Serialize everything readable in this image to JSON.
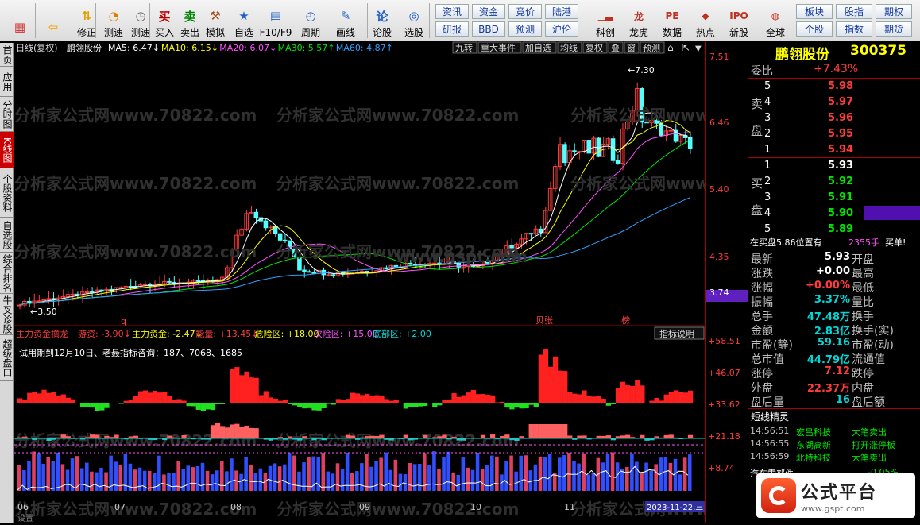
{
  "toolbar": {
    "buttons": [
      {
        "label": "",
        "icon": "grid-icon",
        "color": "#d03030"
      },
      {
        "label": "",
        "icon": "back-arrow-icon",
        "color": "#f0b020"
      },
      {
        "label": "修正",
        "icon": "up-down-arrows-icon",
        "color": "#e0a000"
      },
      {
        "label": "测速",
        "icon": "speedometer-icon",
        "color": "#e08000"
      },
      {
        "label": "测速",
        "icon": "clock-icon",
        "color": "#606060"
      },
      {
        "label": "买入",
        "icon": "buy-icon",
        "color": "#c00000"
      },
      {
        "label": "卖出",
        "icon": "sell-icon",
        "color": "#008000"
      },
      {
        "label": "模拟",
        "icon": "hammer-icon",
        "color": "#a05020"
      },
      {
        "label": "自选",
        "icon": "star-icon",
        "color": "#2060c0"
      },
      {
        "label": "F10/F9",
        "icon": "doc-icon",
        "color": "#2060c0"
      },
      {
        "label": "周期",
        "icon": "clock-cycle-icon",
        "color": "#2060c0"
      },
      {
        "label": "画线",
        "icon": "pen-icon",
        "color": "#2060c0"
      },
      {
        "label": "论股",
        "icon": "forum-icon",
        "color": "#2060c0"
      },
      {
        "label": "选股",
        "icon": "select-stock-icon",
        "color": "#2060c0"
      }
    ],
    "menu_buttons": [
      [
        "资讯",
        "资金",
        "竞价",
        "陆港"
      ],
      [
        "研报",
        "BBD",
        "预测",
        "沪伦"
      ]
    ],
    "buttons2": [
      {
        "label": "科创",
        "icon": "chart-icon"
      },
      {
        "label": "龙虎",
        "icon": "dragon-icon"
      },
      {
        "label": "数据",
        "icon": "pe-icon"
      },
      {
        "label": "热点",
        "icon": "hot-icon"
      },
      {
        "label": "新股",
        "icon": "ipo-icon"
      },
      {
        "label": "全球",
        "icon": "globe-icon"
      }
    ],
    "menu_buttons2": [
      [
        "板块",
        "股指",
        "期权"
      ],
      [
        "个股",
        "指数",
        "期货"
      ]
    ]
  },
  "lefttabs": [
    "首页",
    "应用",
    "分时图",
    "K线图",
    "个股资料",
    "自选股",
    "综合排名",
    "牛叉诊股",
    "超级盘口"
  ],
  "chart": {
    "title": "日线(复权)",
    "stock": "鹏翎股份",
    "ma": [
      {
        "label": "MA5: 6.47↓",
        "color": "#ffffff"
      },
      {
        "label": "MA10: 6.15↓",
        "color": "#ffff00"
      },
      {
        "label": "MA20: 6.07↓",
        "color": "#ff50ff"
      },
      {
        "label": "MA30: 5.57↑",
        "color": "#00e600"
      },
      {
        "label": "MA60: 4.87↑",
        "color": "#30a0ff"
      }
    ],
    "tabs": [
      "九转",
      "重大事件",
      "加自选",
      "均线",
      "复权",
      "叠",
      "窗",
      "预测"
    ],
    "high_label": "7.30",
    "low_label": "3.50",
    "marks": [
      "q",
      "贝张",
      "榜"
    ],
    "price_axis": [
      "7.51",
      "6.46",
      "5.40",
      "4.35",
      "3.74"
    ],
    "watermark": "分析家公式网www.70822.com",
    "watermark2": "www.gspt.com",
    "indicator": {
      "name": "主力资金擒龙",
      "items": [
        {
          "label": "游资: -3.90↓",
          "color": "#ff3c3c"
        },
        {
          "label": "主力资金: -2.47↓",
          "color": "#ffff00"
        },
        {
          "label": "能量: +13.45↓",
          "color": "#ff3c3c"
        },
        {
          "label": "危险区: +18.00",
          "color": "#ffff00"
        },
        {
          "label": "次险区: +15.00",
          "color": "#ff50ff"
        },
        {
          "label": "底部区: +2.00",
          "color": "#00d8d8"
        }
      ],
      "button": "指标说明",
      "note": "试用期到12月10日、老聂指标咨询：187、7068、1685",
      "axis": [
        "+58.51",
        "+46.07",
        "+33.62",
        "+21.18",
        "+8.74"
      ],
      "axis_labels": [
        "游资",
        "主力",
        "能量"
      ]
    },
    "dates": [
      "06",
      "07",
      "08",
      "09",
      "10",
      "11"
    ],
    "cursor_date": "2023-11-22,三",
    "bottom": "设置"
  },
  "panel": {
    "name": "鹏翎股份",
    "code": "300375",
    "weibi_label": "委比",
    "weibi": "+7.43%",
    "sell_label": "卖盘",
    "buy_label": "买盘",
    "sells": [
      {
        "n": "5",
        "p": "5.98"
      },
      {
        "n": "4",
        "p": "5.97"
      },
      {
        "n": "3",
        "p": "5.96"
      },
      {
        "n": "2",
        "p": "5.95"
      },
      {
        "n": "1",
        "p": "5.94"
      }
    ],
    "buys": [
      {
        "n": "1",
        "p": "5.93"
      },
      {
        "n": "2",
        "p": "5.92"
      },
      {
        "n": "3",
        "p": "5.91"
      },
      {
        "n": "4",
        "p": "5.90"
      },
      {
        "n": "5",
        "p": "5.89"
      }
    ],
    "note": {
      "text": "在买盘5.86位置有",
      "amount": "2355手",
      "suffix": "买单!"
    },
    "stats": [
      [
        "最新",
        "5.93",
        "开盘",
        ""
      ],
      [
        "涨跌",
        "+0.00",
        "最高",
        ""
      ],
      [
        "涨幅",
        "+0.00%",
        "最低",
        ""
      ],
      [
        "振幅",
        "3.37%",
        "量比",
        ""
      ],
      [
        "总手",
        "47.48万",
        "换手",
        ""
      ],
      [
        "金额",
        "2.83亿",
        "换手(实)",
        ""
      ],
      [
        "市盈(静)",
        "59.16",
        "市盈(动)",
        ""
      ],
      [
        "总市值",
        "44.79亿",
        "流通值",
        ""
      ],
      [
        "涨停",
        "7.12",
        "跌停",
        ""
      ],
      [
        "外盘",
        "22.37万",
        "内盘",
        ""
      ],
      [
        "盘后量",
        "16",
        "盘后额",
        ""
      ]
    ],
    "feed_title": "短线精灵",
    "feed": [
      [
        "14:56:51",
        "宏昌科技",
        "大笔卖出"
      ],
      [
        "14:56:55",
        "东湖高新",
        "打开涨停板"
      ],
      [
        "14:56:59",
        "北特科技",
        "大笔卖出"
      ]
    ],
    "last": {
      "name": "汽车零部件",
      "value": "-0.05%"
    },
    "logo": "公式平台",
    "logo_url": "www.gspt.com"
  }
}
